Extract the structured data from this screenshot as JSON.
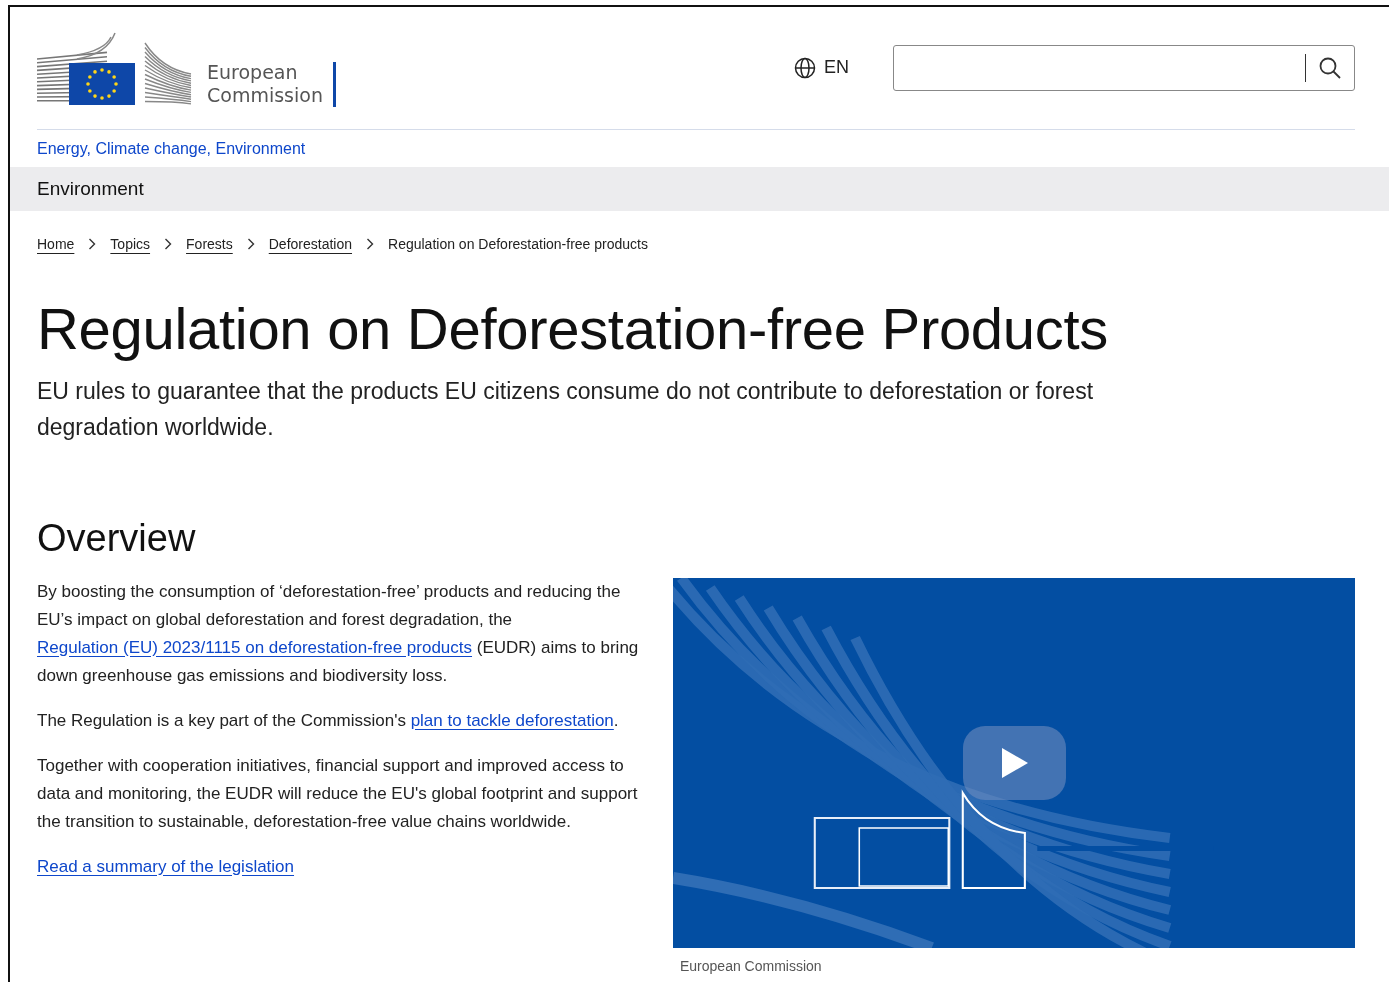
{
  "header": {
    "logo_text": "European Commission",
    "language": "EN"
  },
  "site_name": "Energy, Climate change, Environment",
  "section_bar": "Environment",
  "breadcrumb": [
    {
      "label": "Home",
      "kind": "link"
    },
    {
      "label": "Topics",
      "kind": "link"
    },
    {
      "label": "Forests",
      "kind": "link"
    },
    {
      "label": "Deforestation",
      "kind": "link"
    },
    {
      "label": "Regulation on Deforestation-free products",
      "kind": "current"
    }
  ],
  "title": "Regulation on Deforestation-free Products",
  "subtitle": "EU rules to guarantee that the products EU citizens consume do not contribute to deforestation or forest degradation worldwide.",
  "overview": {
    "heading": "Overview",
    "paragraphs": [
      [
        {
          "text": "By boosting the consumption of ‘deforestation-free’ products and reducing the EU’s impact on global deforestation and forest degradation, the ",
          "kind": "text"
        },
        {
          "text": "Regulation (EU) 2023/1115 on deforestation-free products",
          "kind": "link"
        },
        {
          "text": " (EUDR) aims to bring down greenhouse gas emissions and biodiversity loss.",
          "kind": "text"
        }
      ],
      [
        {
          "text": "The Regulation is a key part of the Commission's ",
          "kind": "text"
        },
        {
          "text": "plan to tackle deforestation",
          "kind": "link"
        },
        {
          "text": ".",
          "kind": "text"
        }
      ],
      [
        {
          "text": "Together with cooperation initiatives, financial support and improved access to data and monitoring, the EUDR will reduce the EU's global footprint and support the transition to sustainable, deforestation-free value chains worldwide.",
          "kind": "text"
        }
      ]
    ],
    "summary_link": "Read a summary of the legislation",
    "video": {
      "kind": "picture",
      "caption": "European Commission"
    }
  }
}
